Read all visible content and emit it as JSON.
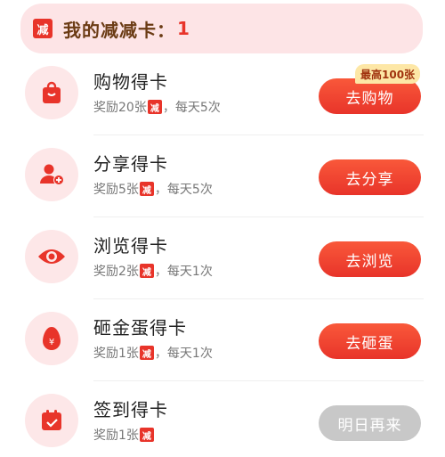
{
  "header": {
    "badge": "减",
    "title": "我的减减卡：",
    "count": "1"
  },
  "tasks": [
    {
      "title": "购物得卡",
      "reward_prefix": "奖励20张",
      "tag": "减",
      "reward_suffix": "，每天5次",
      "button": "去购物",
      "limit_badge": "最高100张",
      "icon": "shopping-bag-icon"
    },
    {
      "title": "分享得卡",
      "reward_prefix": "奖励5张",
      "tag": "减",
      "reward_suffix": "，每天5次",
      "button": "去分享",
      "icon": "user-add-icon"
    },
    {
      "title": "浏览得卡",
      "reward_prefix": "奖励2张",
      "tag": "减",
      "reward_suffix": "，每天1次",
      "button": "去浏览",
      "icon": "eye-icon"
    },
    {
      "title": "砸金蛋得卡",
      "reward_prefix": "奖励1张",
      "tag": "减",
      "reward_suffix": "，每天1次",
      "button": "去砸蛋",
      "icon": "golden-egg-icon"
    },
    {
      "title": "签到得卡",
      "reward_prefix": "奖励1张",
      "tag": "减",
      "reward_suffix": "",
      "button": "明日再来",
      "icon": "calendar-check-icon"
    }
  ],
  "colors": {
    "accent": "#e8342a",
    "header_bg": "#fde4e6",
    "icon_bg": "#fde7e8",
    "disabled": "#c8c8c8"
  }
}
